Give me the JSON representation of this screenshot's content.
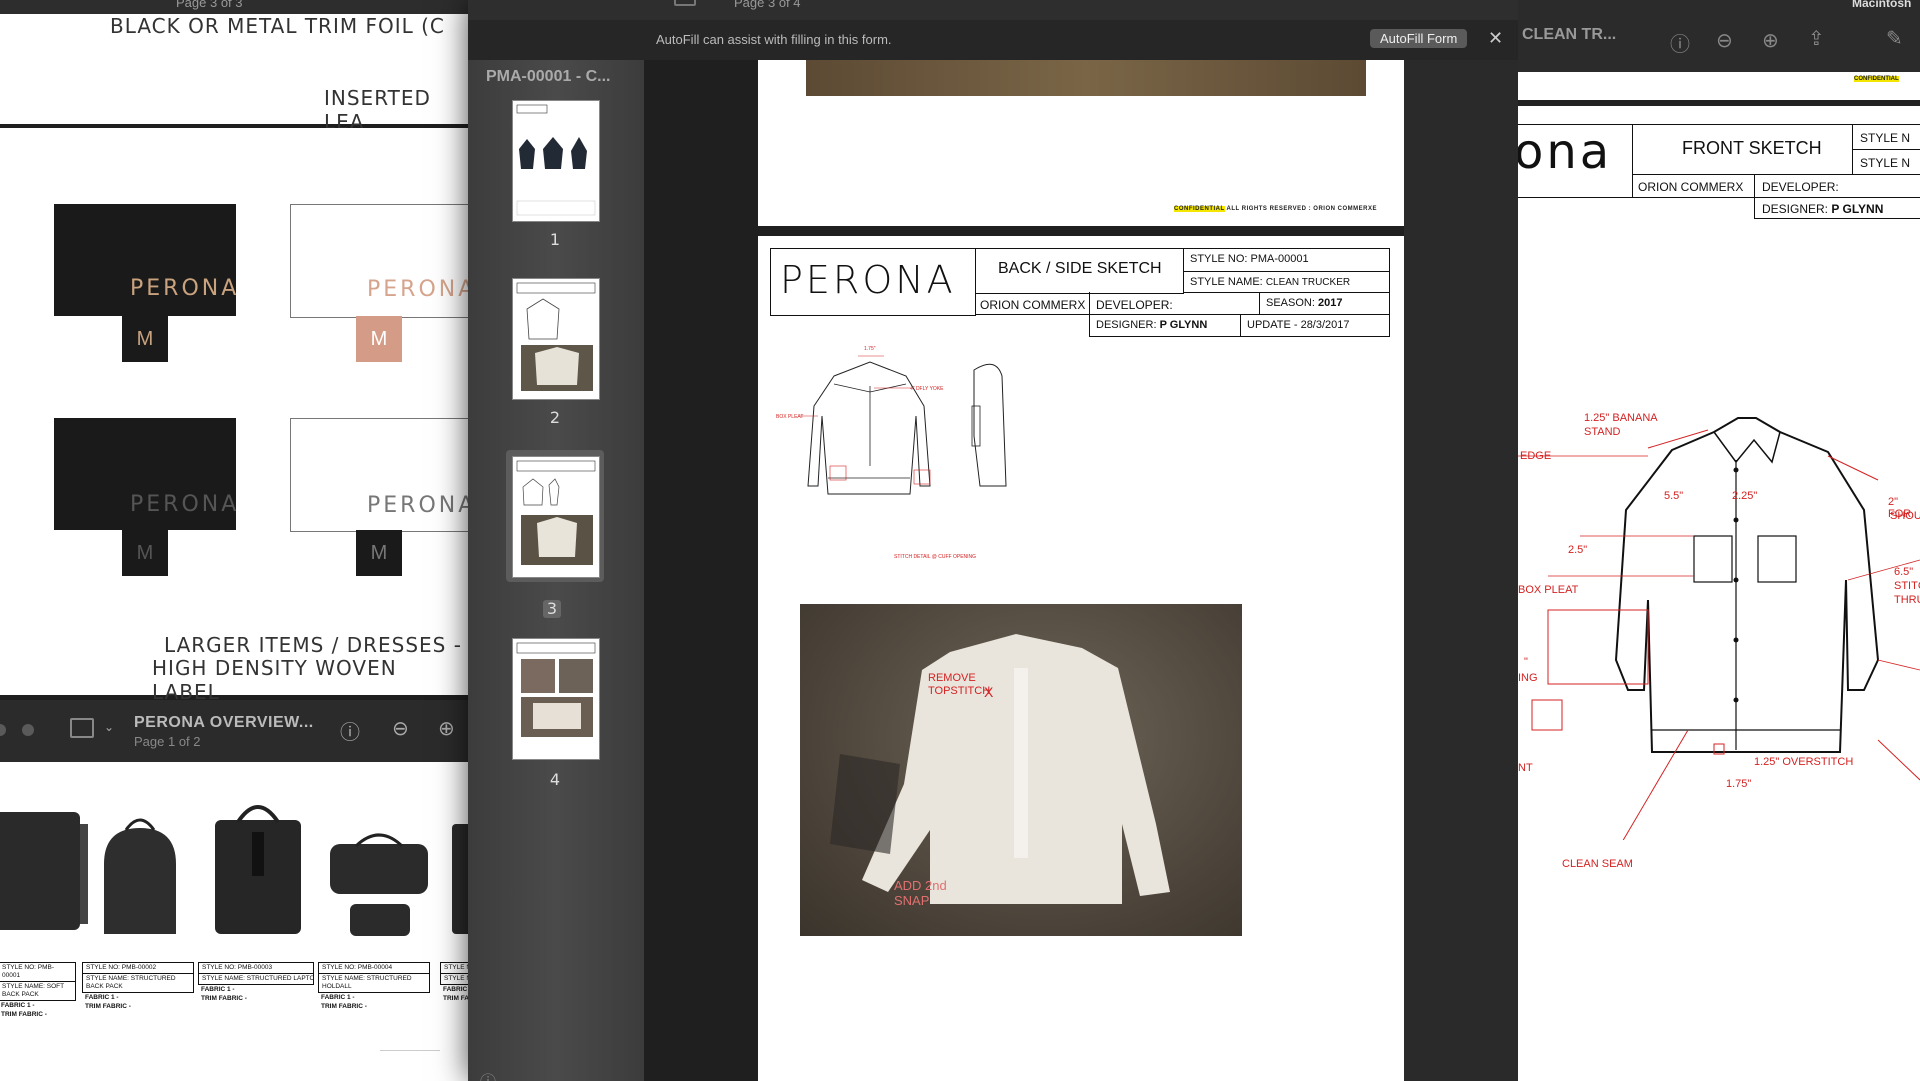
{
  "left_window": {
    "page_indicator": "Page 3 of 3",
    "cut_heading": "BLACK OR METAL TRIM FOIL (C",
    "inserted_label": "INSERTED LEA",
    "labels": [
      {
        "brand": "PERONA",
        "tag": "M"
      },
      {
        "brand": "PERONA",
        "tag": "M"
      },
      {
        "brand": "PERONA",
        "tag": "M"
      },
      {
        "brand": "PERONA",
        "tag": "M"
      }
    ],
    "caption_line1": "LARGER ITEMS / DRESSES -",
    "caption_line2": "HIGH DENSITY WOVEN LABEL"
  },
  "lower_left_window": {
    "title": "PERONA OVERVIEW...",
    "subtitle": "Page 1 of 2",
    "products": [
      {
        "style_no": "STYLE NO:  PMB-00001",
        "style_name": "STYLE NAME:  SOFT BACK PACK",
        "fabric": "FABRIC 1 -",
        "trim": "TRIM FABRIC -"
      },
      {
        "style_no": "STYLE NO:  PMB-00002",
        "style_name": "STYLE NAME:  STRUCTURED BACK PACK",
        "fabric": "FABRIC 1 -",
        "trim": "TRIM FABRIC -"
      },
      {
        "style_no": "STYLE NO:  PMB-00003",
        "style_name": "STYLE NAME:  STRUCTURED LAPTOP/TOTE",
        "fabric": "FABRIC 1 -",
        "trim": "TRIM FABRIC -"
      },
      {
        "style_no": "STYLE NO:  PMB-00004",
        "style_name": "STYLE NAME:  STRUCTURED HOLDALL",
        "fabric": "FABRIC 1 -",
        "trim": "TRIM FABRIC -"
      },
      {
        "style_no": "STYLE N",
        "style_name": "STYLE NA",
        "fabric": "FABRIC 1",
        "trim": "TRIM FAB"
      }
    ]
  },
  "center_window": {
    "page_indicator": "Page 3 of 4",
    "autofill_message": "AutoFill can assist with filling in this form.",
    "autofill_button": "AutoFill Form",
    "sidebar_title": "PMA-00001 - C...",
    "thumbnails": [
      {
        "number": "1",
        "selected": false
      },
      {
        "number": "2",
        "selected": false
      },
      {
        "number": "3",
        "selected": true
      },
      {
        "number": "4",
        "selected": false
      }
    ],
    "confidential_highlight": "CONFIDENTIAL",
    "confidential_rest": "ALL RIGHTS RESERVED : ORION COMMERXE",
    "sheet": {
      "brand": "PERONA",
      "title": "BACK / SIDE SKETCH",
      "company": "ORION COMMERX",
      "style_no_label": "STYLE NO:",
      "style_no": "PMA-00001",
      "style_name_label": "STYLE NAME:",
      "style_name": "CLEAN TRUCKER",
      "developer_label": "DEVELOPER:",
      "season_label": "SEASON:",
      "season": "2017",
      "designer_label": "DESIGNER:",
      "designer": "P GLYNN",
      "update_label": "UPDATE - 28/3/2017"
    },
    "sketch_notes": {
      "top": "1.75\"",
      "yoke": "4\" DFLY YOKE",
      "box_pleat": "BOX PLEAT",
      "stitch": "STITCH DETAIL @ CUFF OPENING"
    },
    "photo_notes": {
      "remove_1": "REMOVE",
      "remove_2": "TOPSTITCH",
      "remove_x": "X",
      "snap_1": "ADD 2nd",
      "snap_2": "SNAP"
    }
  },
  "right_window": {
    "title": "CLEAN TR...",
    "user_fragment": "Macintosh",
    "confidential": "CONFIDENTIAL",
    "brand_fragment": "ona",
    "sheet": {
      "title": "FRONT SKETCH",
      "company": "ORION COMMERX",
      "developer_label": "DEVELOPER:",
      "designer_label": "DESIGNER:",
      "designer": "P GLYNN",
      "style_n1": "STYLE N",
      "style_n2": "STYLE N"
    },
    "annotations": {
      "banana1": "1.25\" BANANA",
      "banana2": "STAND",
      "edge": "EDGE",
      "m55": "5.5\"",
      "m225": "2.25\"",
      "for1": "2\" FOR",
      "for2": "SHOU",
      "m25": "2.5\"",
      "m65": "6.5\"",
      "stit": "STITC",
      "thru": "THRU",
      "boxpleat": "BOX PLEAT",
      "ing": "ING",
      "mq": "\"",
      "nt": "NT",
      "overstitch": "1.25\" OVERSTITCH",
      "m175": "1.75\"",
      "cleanseam": "CLEAN SEAM"
    }
  },
  "colors": {
    "annotation_red": "#d42222",
    "toolbar": "#2b2b2b",
    "sidebar": "#3a3a3a",
    "autofill_bar": "#232323",
    "highlight": "#f5e600"
  }
}
